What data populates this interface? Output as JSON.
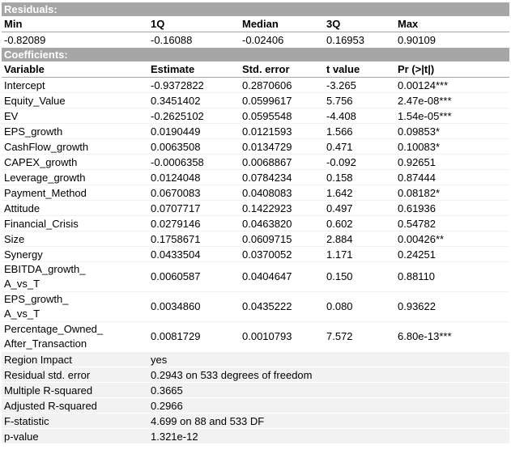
{
  "residuals": {
    "section_title": "Residuals:",
    "headers": [
      "Min",
      "1Q",
      "Median",
      "3Q",
      "Max"
    ],
    "values": [
      "-0.82089",
      "-0.16088",
      "-0.02406",
      "0.16953",
      "0.90109"
    ]
  },
  "coefficients": {
    "section_title": "Coefficients:",
    "headers": [
      "Variable",
      "Estimate",
      "Std. error",
      "t value",
      "Pr (>|t|)"
    ],
    "rows": [
      {
        "variable": "Intercept",
        "estimate": "-0.9372822",
        "std_error": "0.2870606",
        "t_value": "-3.265",
        "p": "0.00124***"
      },
      {
        "variable": "Equity_Value",
        "estimate": "0.3451402",
        "std_error": "0.0599617",
        "t_value": "5.756",
        "p": "2.47e-08***"
      },
      {
        "variable": "EV",
        "estimate": "-0.2625102",
        "std_error": "0.0595548",
        "t_value": "-4.408",
        "p": "1.54e-05***"
      },
      {
        "variable": "EPS_growth",
        "estimate": "0.0190449",
        "std_error": "0.0121593",
        "t_value": "1.566",
        "p": "0.09853*"
      },
      {
        "variable": "CashFlow_growth",
        "estimate": "0.0063508",
        "std_error": "0.0134729",
        "t_value": "0.471",
        "p": "0.10083*"
      },
      {
        "variable": "CAPEX_growth",
        "estimate": "-0.0006358",
        "std_error": "0.0068867",
        "t_value": "-0.092",
        "p": "0.92651"
      },
      {
        "variable": "Leverage_growth",
        "estimate": "0.0124048",
        "std_error": "0.0784234",
        "t_value": "0.158",
        "p": "0.87444"
      },
      {
        "variable": "Payment_Method",
        "estimate": "0.0670083",
        "std_error": "0.0408083",
        "t_value": "1.642",
        "p": "0.08182*"
      },
      {
        "variable": "Attitude",
        "estimate": "0.0707717",
        "std_error": "0.1422923",
        "t_value": "0.497",
        "p": "0.61936"
      },
      {
        "variable": "Financial_Crisis",
        "estimate": "0.0279146",
        "std_error": "0.0463820",
        "t_value": "0.602",
        "p": "0.54782"
      },
      {
        "variable": "Size",
        "estimate": "0.1758671",
        "std_error": "0.0609715",
        "t_value": "2.884",
        "p": "0.00426**"
      },
      {
        "variable": "Synergy",
        "estimate": "0.0433504",
        "std_error": "0.0370052",
        "t_value": "1.171",
        "p": "0.24251"
      }
    ],
    "wrapped_rows": [
      {
        "variable_line1": "EBITDA_growth_",
        "variable_line2": "A_vs_T",
        "estimate": "0.0060587",
        "std_error": "0.0404647",
        "t_value": "0.150",
        "p": "0.88110"
      },
      {
        "variable_line1": "EPS_growth_",
        "variable_line2": "A_vs_T",
        "estimate": "0.0034860",
        "std_error": "0.0435222",
        "t_value": "0.080",
        "p": "0.93622"
      },
      {
        "variable_line1": "Percentage_Owned_",
        "variable_line2": "After_Transaction",
        "estimate": "0.0081729",
        "std_error": "0.0010793",
        "t_value": "7.572",
        "p": "6.80e-13***"
      }
    ]
  },
  "stats": [
    {
      "label": "Region Impact",
      "value": "yes"
    },
    {
      "label": "Residual std. error",
      "value": "0.2943 on 533 degrees of freedom"
    },
    {
      "label": "Multiple R-squared",
      "value": "0.3665"
    },
    {
      "label": "Adjusted R-squared",
      "value": "0.2966"
    },
    {
      "label": "F-statistic",
      "value": "4.699 on 88 and 533 DF"
    },
    {
      "label": "p-value",
      "value": "1.321e-12"
    }
  ]
}
